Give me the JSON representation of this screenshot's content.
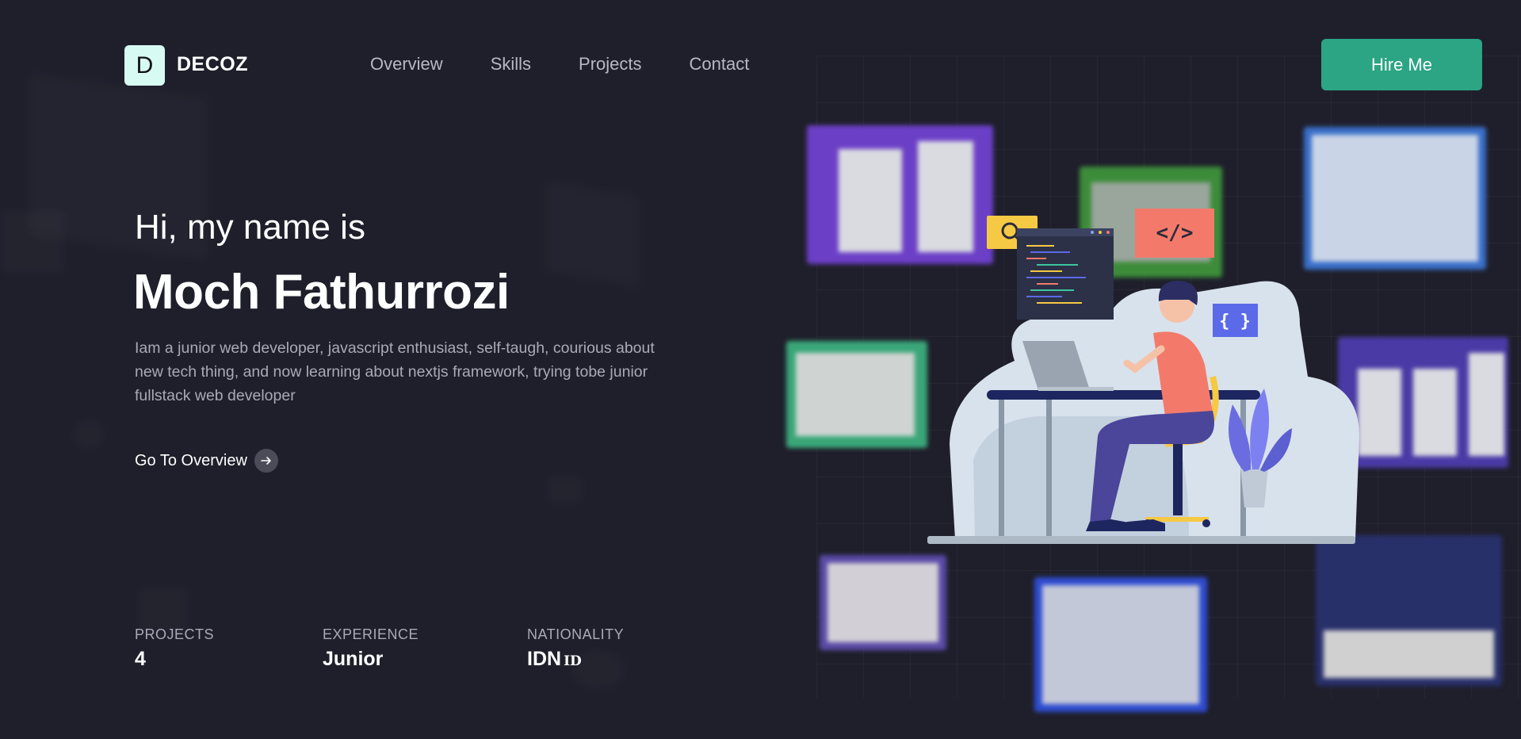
{
  "header": {
    "logo_letter": "D",
    "logo_text": "DECOZ",
    "nav": [
      "Overview",
      "Skills",
      "Projects",
      "Contact"
    ],
    "hire_label": "Hire Me"
  },
  "hero": {
    "greeting": "Hi, my name is",
    "name": "Moch Fathurrozi",
    "description": "Iam a junior web developer, javascript enthusiast, self-taugh, courious about new tech thing, and now learning about nextjs framework, trying tobe junior fullstack web developer",
    "cta_label": "Go To Overview"
  },
  "stats": [
    {
      "label": "PROJECTS",
      "value": "4"
    },
    {
      "label": "EXPERIENCE",
      "value": "Junior"
    },
    {
      "label": "NATIONALITY",
      "value": "IDN",
      "flag": "ID"
    }
  ],
  "illustration": {
    "code_tag": "</>",
    "braces_tag": "{ }"
  },
  "colors": {
    "background": "#1f1f2b",
    "accent": "#2ba583",
    "logo_bg": "#d7fbf3"
  }
}
